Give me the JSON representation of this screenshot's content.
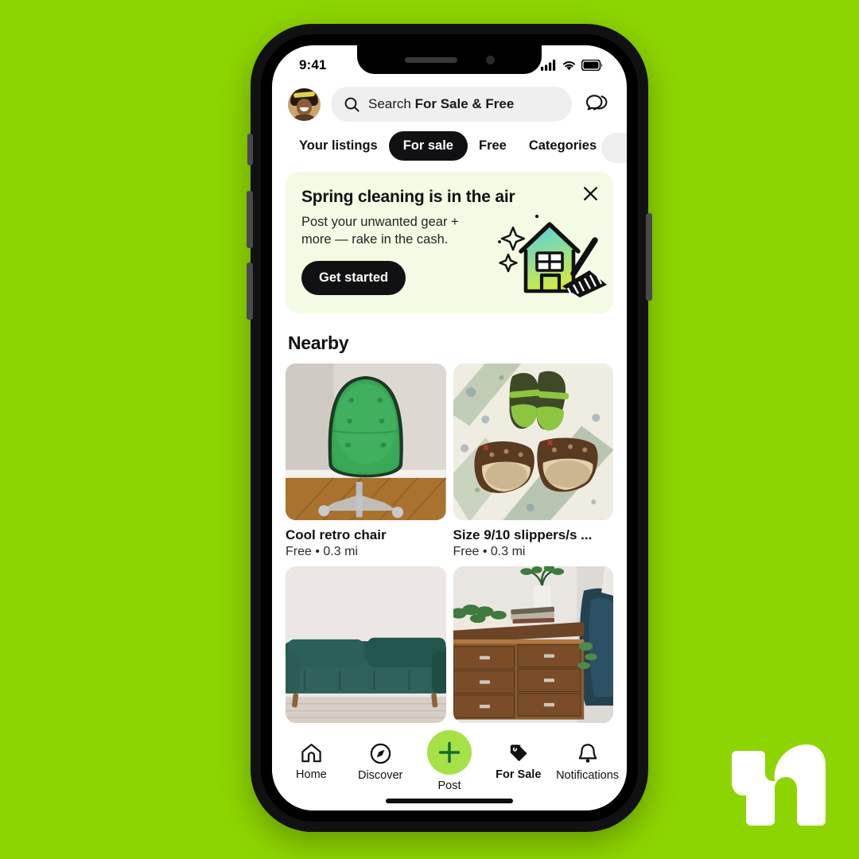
{
  "brand": {
    "logo_name": "nextdoor-logo",
    "background_color": "#8dd500",
    "accent_color": "#a6e247",
    "dark_color": "#111113"
  },
  "status_bar": {
    "time": "9:41",
    "cellular_icon": "signal-bars-icon",
    "wifi_icon": "wifi-icon",
    "battery_icon": "battery-full-icon"
  },
  "header": {
    "avatar_name": "user-avatar",
    "search": {
      "icon": "search-icon",
      "label_prefix": "Search ",
      "label_bold": "For Sale & Free",
      "placeholder": "Search For Sale & Free",
      "value": ""
    },
    "messages_icon": "chat-bubbles-icon"
  },
  "tabs": {
    "items": [
      {
        "label": "Your listings",
        "active": false
      },
      {
        "label": "For sale",
        "active": true
      },
      {
        "label": "Free",
        "active": false
      },
      {
        "label": "Categories",
        "active": false,
        "icon": "chevron-down-icon"
      }
    ]
  },
  "promo": {
    "title": "Spring cleaning is in the air",
    "subtitle": "Post your unwanted gear + more — rake in the cash.",
    "cta_label": "Get started",
    "close_icon": "close-icon",
    "art_name": "house-with-rake-illustration",
    "background_color": "#f4fbe4",
    "art_gradient_from": "#5fd0d8",
    "art_gradient_to": "#c9e84a"
  },
  "nearby": {
    "title": "Nearby",
    "listings": [
      {
        "title": "Cool retro chair",
        "price": "Free",
        "distance": "0.3 mi",
        "meta": "Free • 0.3 mi",
        "image": "green-retro-office-chair-photo"
      },
      {
        "title": "Size 9/10 slippers/s ...",
        "price": "Free",
        "distance": "0.3 mi",
        "meta": "Free • 0.3 mi",
        "image": "brown-slippers-and-shoes-photo"
      },
      {
        "title": "",
        "price": "",
        "distance": "",
        "meta": "",
        "image": "green-velvet-sofa-photo"
      },
      {
        "title": "",
        "price": "",
        "distance": "",
        "meta": "",
        "image": "wooden-dresser-photo"
      }
    ]
  },
  "bottom_nav": {
    "items": [
      {
        "label": "Home",
        "icon": "home-icon",
        "active": false
      },
      {
        "label": "Discover",
        "icon": "compass-icon",
        "active": false
      },
      {
        "label": "Post",
        "icon": "plus-icon",
        "active": false,
        "fab": true
      },
      {
        "label": "For Sale",
        "icon": "price-tag-icon",
        "active": true
      },
      {
        "label": "Notifications",
        "icon": "bell-icon",
        "active": false
      }
    ]
  }
}
